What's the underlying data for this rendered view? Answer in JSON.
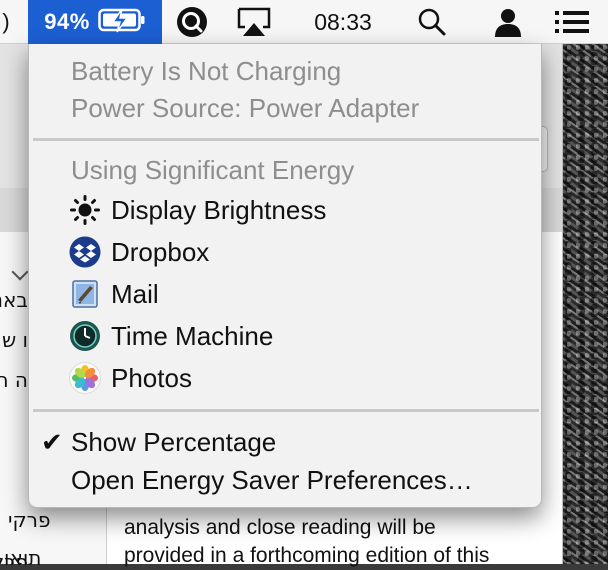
{
  "menubar": {
    "battery_percent": "94%",
    "clock": "08:33",
    "left_fragment": ")",
    "icons": [
      "battery-charging-icon",
      "quicktime-icon",
      "airplay-icon",
      "search-icon",
      "user-icon",
      "menu-list-icon"
    ]
  },
  "battery_menu": {
    "status_line": "Battery Is Not Charging",
    "power_source": "Power Source: Power Adapter",
    "section_header": "Using Significant Energy",
    "apps": [
      {
        "label": "Display Brightness",
        "icon": "sun-icon"
      },
      {
        "label": "Dropbox",
        "icon": "dropbox-icon"
      },
      {
        "label": "Mail",
        "icon": "mail-icon"
      },
      {
        "label": "Time Machine",
        "icon": "time-machine-icon"
      },
      {
        "label": "Photos",
        "icon": "photos-icon"
      }
    ],
    "show_percentage": "Show Percentage",
    "show_percentage_checked": true,
    "open_prefs": "Open Energy Saver Preferences…"
  },
  "background_document": {
    "sidebar_lines": [
      "באנ",
      "ו ש",
      "ה ה",
      "פרקי",
      "תואו"
    ],
    "body_text_lines": [
      "analysis and close reading will be",
      "provided in a forthcoming edition of this"
    ]
  },
  "colors": {
    "menubar_bg": "#f6f6f6",
    "highlight": "#1c5fd3",
    "menu_bg": "#f2f2f2",
    "disabled_text": "#8e8e8e"
  }
}
